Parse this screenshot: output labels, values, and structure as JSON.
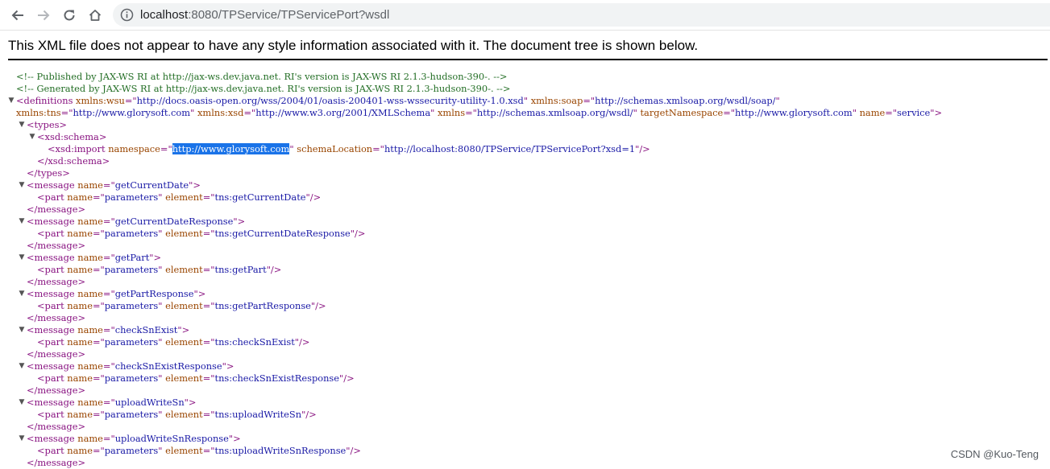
{
  "browser": {
    "url_host": "localhost",
    "url_rest": ":8080/TPService/TPServicePort?wsdl"
  },
  "xml_header": "This XML file does not appear to have any style information associated with it. The document tree is shown below.",
  "tree": {
    "comment1": "<!--  Published by JAX-WS RI at http://jax-ws.dev.java.net. RI's version is JAX-WS RI 2.1.3-hudson-390-.  -->",
    "comment2": "<!--  Generated by JAX-WS RI at http://jax-ws.dev.java.net. RI's version is JAX-WS RI 2.1.3-hudson-390-.  -->",
    "definitions": {
      "wsu": "http://docs.oasis-open.org/wss/2004/01/oasis-200401-wss-wssecurity-utility-1.0.xsd",
      "soap": "http://schemas.xmlsoap.org/wsdl/soap/",
      "tns": "http://www.glorysoft.com",
      "xsd": "http://www.w3.org/2001/XMLSchema",
      "xmlns": "http://schemas.xmlsoap.org/wsdl/",
      "targetNamespace": "http://www.glorysoft.com",
      "name": "service"
    },
    "import": {
      "namespace": "http://www.glorysoft.com",
      "schemaLocation": "http://localhost:8080/TPService/TPServicePort?xsd=1"
    },
    "messages": [
      {
        "name": "getCurrentDate",
        "part_name": "parameters",
        "element": "tns:getCurrentDate"
      },
      {
        "name": "getCurrentDateResponse",
        "part_name": "parameters",
        "element": "tns:getCurrentDateResponse"
      },
      {
        "name": "getPart",
        "part_name": "parameters",
        "element": "tns:getPart"
      },
      {
        "name": "getPartResponse",
        "part_name": "parameters",
        "element": "tns:getPartResponse"
      },
      {
        "name": "checkSnExist",
        "part_name": "parameters",
        "element": "tns:checkSnExist"
      },
      {
        "name": "checkSnExistResponse",
        "part_name": "parameters",
        "element": "tns:checkSnExistResponse"
      },
      {
        "name": "uploadWriteSn",
        "part_name": "parameters",
        "element": "tns:uploadWriteSn"
      },
      {
        "name": "uploadWriteSnResponse",
        "part_name": "parameters",
        "element": "tns:uploadWriteSnResponse"
      }
    ]
  },
  "watermark": "CSDN @Kuo-Teng"
}
